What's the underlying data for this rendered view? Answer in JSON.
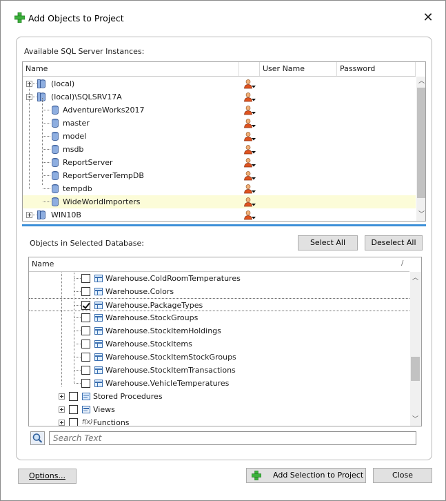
{
  "window": {
    "title": "Add Objects to Project",
    "close_glyph": "✕"
  },
  "instances": {
    "section_label": "Available SQL Server Instances:",
    "columns": [
      "Name",
      "",
      "User Name",
      "Password"
    ],
    "rows": [
      {
        "label": "(local)",
        "kind": "server",
        "expander": "plus"
      },
      {
        "label": "(local)\\SQLSRV17A",
        "kind": "server",
        "expander": "minus"
      },
      {
        "label": "AdventureWorks2017",
        "kind": "database"
      },
      {
        "label": "master",
        "kind": "database"
      },
      {
        "label": "model",
        "kind": "database"
      },
      {
        "label": "msdb",
        "kind": "database"
      },
      {
        "label": "ReportServer",
        "kind": "database"
      },
      {
        "label": "ReportServerTempDB",
        "kind": "database"
      },
      {
        "label": "tempdb",
        "kind": "database"
      },
      {
        "label": "WideWorldImporters",
        "kind": "database",
        "selected": true
      },
      {
        "label": "WIN10B",
        "kind": "server",
        "expander": "plus"
      }
    ]
  },
  "objects": {
    "section_label": "Objects in Selected Database:",
    "select_all_label": "Select All",
    "deselect_all_label": "Deselect All",
    "column_name": "Name",
    "column_sort_glyph": "/",
    "rows": [
      {
        "label": "Warehouse.ColdRoomTemperatures",
        "checked": false
      },
      {
        "label": "Warehouse.Colors",
        "checked": false
      },
      {
        "label": "Warehouse.PackageTypes",
        "checked": true,
        "focused": true
      },
      {
        "label": "Warehouse.StockGroups",
        "checked": false
      },
      {
        "label": "Warehouse.StockItemHoldings",
        "checked": false
      },
      {
        "label": "Warehouse.StockItems",
        "checked": false
      },
      {
        "label": "Warehouse.StockItemStockGroups",
        "checked": false
      },
      {
        "label": "Warehouse.StockItemTransactions",
        "checked": false
      },
      {
        "label": "Warehouse.VehicleTemperatures",
        "checked": false
      }
    ],
    "groups": [
      {
        "label": "Stored Procedures",
        "icon": "stored-procedure-icon"
      },
      {
        "label": "Views",
        "icon": "view-icon"
      },
      {
        "label": "Functions",
        "icon": "function-icon"
      }
    ],
    "search_placeholder": "Search Text"
  },
  "footer": {
    "options_label": "Options...",
    "add_selection_label": "Add Selection to Project",
    "close_label": "Close"
  },
  "colors": {
    "accent": "#3c8fd8",
    "selected_row": "#fcfcd8",
    "add_icon_green": "#3db13d"
  }
}
